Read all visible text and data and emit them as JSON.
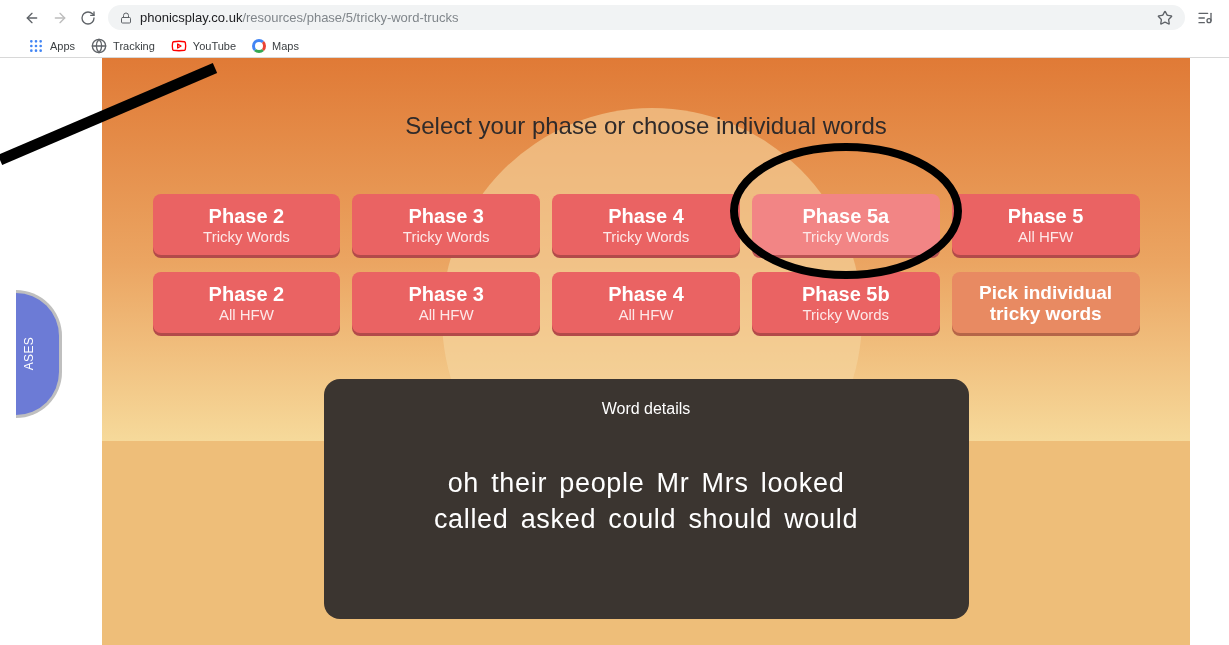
{
  "browser": {
    "address": {
      "domain": "phonicsplay.co.uk",
      "path": "/resources/phase/5/tricky-word-trucks"
    },
    "bookmarks": [
      {
        "kind": "apps",
        "label": "Apps"
      },
      {
        "kind": "globe",
        "label": "Tracking"
      },
      {
        "kind": "youtube",
        "label": "YouTube"
      },
      {
        "kind": "google",
        "label": "Maps"
      }
    ]
  },
  "side_tab": {
    "label": "ASES"
  },
  "heading": "Select your phase or choose individual words",
  "phase_buttons": [
    {
      "kind": "phase",
      "title": "Phase 2",
      "subtitle": "Tricky Words",
      "highlighted": false
    },
    {
      "kind": "phase",
      "title": "Phase 3",
      "subtitle": "Tricky Words",
      "highlighted": false
    },
    {
      "kind": "phase",
      "title": "Phase 4",
      "subtitle": "Tricky Words",
      "highlighted": false
    },
    {
      "kind": "phase",
      "title": "Phase 5a",
      "subtitle": "Tricky Words",
      "highlighted": true
    },
    {
      "kind": "phase",
      "title": "Phase 5",
      "subtitle": "All HFW",
      "highlighted": false
    },
    {
      "kind": "phase",
      "title": "Phase 2",
      "subtitle": "All HFW",
      "highlighted": false
    },
    {
      "kind": "phase",
      "title": "Phase 3",
      "subtitle": "All HFW",
      "highlighted": false
    },
    {
      "kind": "phase",
      "title": "Phase 4",
      "subtitle": "All HFW",
      "highlighted": false
    },
    {
      "kind": "phase",
      "title": "Phase 5b",
      "subtitle": "Tricky Words",
      "highlighted": false
    },
    {
      "kind": "pick",
      "title": "Pick individual tricky words",
      "highlighted": false
    }
  ],
  "word_details": {
    "title": "Word details",
    "lines": [
      "oh their people Mr Mrs looked",
      "called asked could should would"
    ]
  }
}
